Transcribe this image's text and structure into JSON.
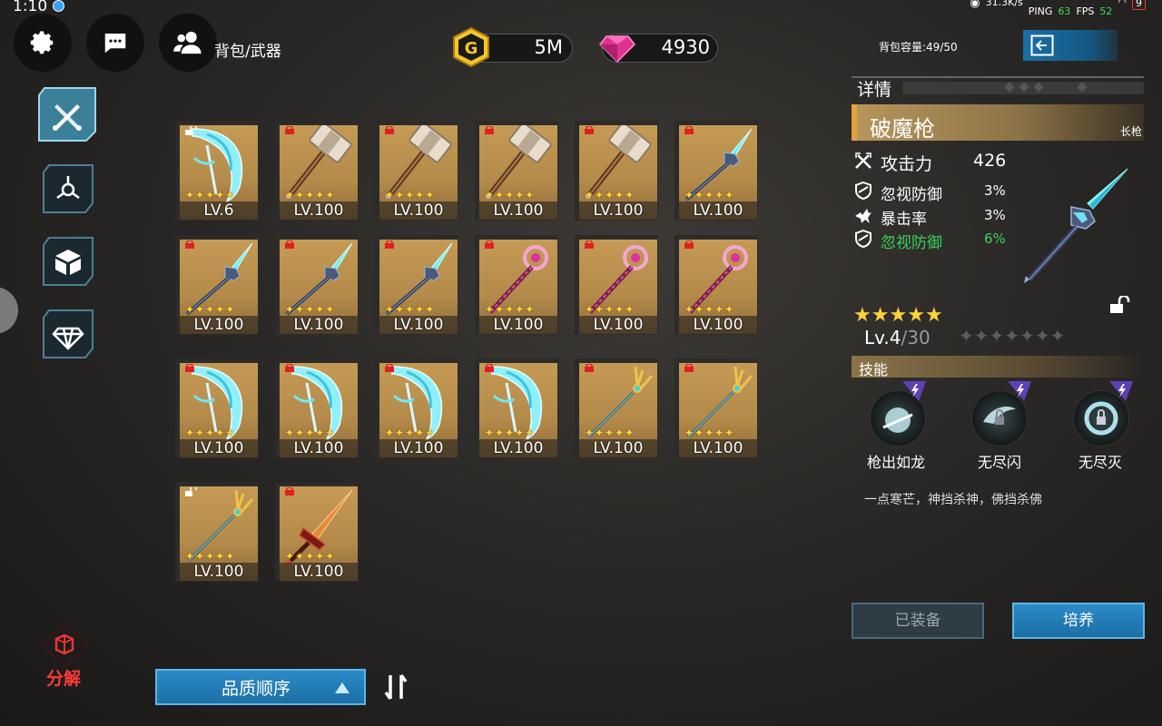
{
  "status": {
    "time": "1:10",
    "net": "31.3K/s",
    "ping_label": "PING",
    "ping_val": "63",
    "fps_label": "FPS",
    "fps_val": "52",
    "battery": "9"
  },
  "header": {
    "title": "背包/武器",
    "gold": "5M",
    "gems": "4930",
    "capacity": "背包容量:49/50"
  },
  "grid": {
    "slots": [
      {
        "art": "scythe",
        "level": "LV.6",
        "locked": false
      },
      {
        "art": "hammer",
        "level": "LV.100",
        "locked": true
      },
      {
        "art": "hammer",
        "level": "LV.100",
        "locked": true
      },
      {
        "art": "hammer",
        "level": "LV.100",
        "locked": true
      },
      {
        "art": "hammer",
        "level": "LV.100",
        "locked": true
      },
      {
        "art": "spear",
        "level": "LV.100",
        "locked": true
      },
      {
        "art": "spear",
        "level": "LV.100",
        "locked": true
      },
      {
        "art": "spear",
        "level": "LV.100",
        "locked": true
      },
      {
        "art": "spear",
        "level": "LV.100",
        "locked": true
      },
      {
        "art": "staff",
        "level": "LV.100",
        "locked": true
      },
      {
        "art": "staff",
        "level": "LV.100",
        "locked": true
      },
      {
        "art": "staff",
        "level": "LV.100",
        "locked": true
      },
      {
        "art": "scythe",
        "level": "LV.100",
        "locked": true
      },
      {
        "art": "scythe",
        "level": "LV.100",
        "locked": true
      },
      {
        "art": "scythe",
        "level": "LV.100",
        "locked": true
      },
      {
        "art": "scythe",
        "level": "LV.100",
        "locked": true
      },
      {
        "art": "trident",
        "level": "LV.100",
        "locked": true
      },
      {
        "art": "trident",
        "level": "LV.100",
        "locked": true
      },
      {
        "art": "trident",
        "level": "LV.100",
        "locked": false
      },
      {
        "art": "sword",
        "level": "LV.100",
        "locked": true
      }
    ]
  },
  "detail": {
    "title": "详情",
    "name": "破魔枪",
    "type": "长枪",
    "stats": [
      {
        "label": "攻击力",
        "value": "426",
        "green": false
      },
      {
        "label": "忽视防御",
        "value": "3%",
        "green": false
      },
      {
        "label": "暴击率",
        "value": "3%",
        "green": false
      },
      {
        "label": "忽视防御",
        "value": "6%",
        "green": true
      }
    ],
    "stars_filled": 5,
    "stars_empty": 7,
    "level": "Lv.4",
    "level_max": "/30",
    "skills_title": "技能",
    "skills": [
      {
        "name": "枪出如龙"
      },
      {
        "name": "无尽闪"
      },
      {
        "name": "无尽灭"
      }
    ],
    "description": "一点寒芒，神挡杀神，佛挡杀佛",
    "btn_equipped": "已装备",
    "btn_train": "培养"
  },
  "bottom": {
    "sort_label": "品质顺序",
    "decompose_label": "分解"
  },
  "colors": {
    "accent_blue": "#2c8bc7",
    "gold_card": "#c59a55",
    "green": "#37d45a",
    "red": "#ff3b3b"
  }
}
